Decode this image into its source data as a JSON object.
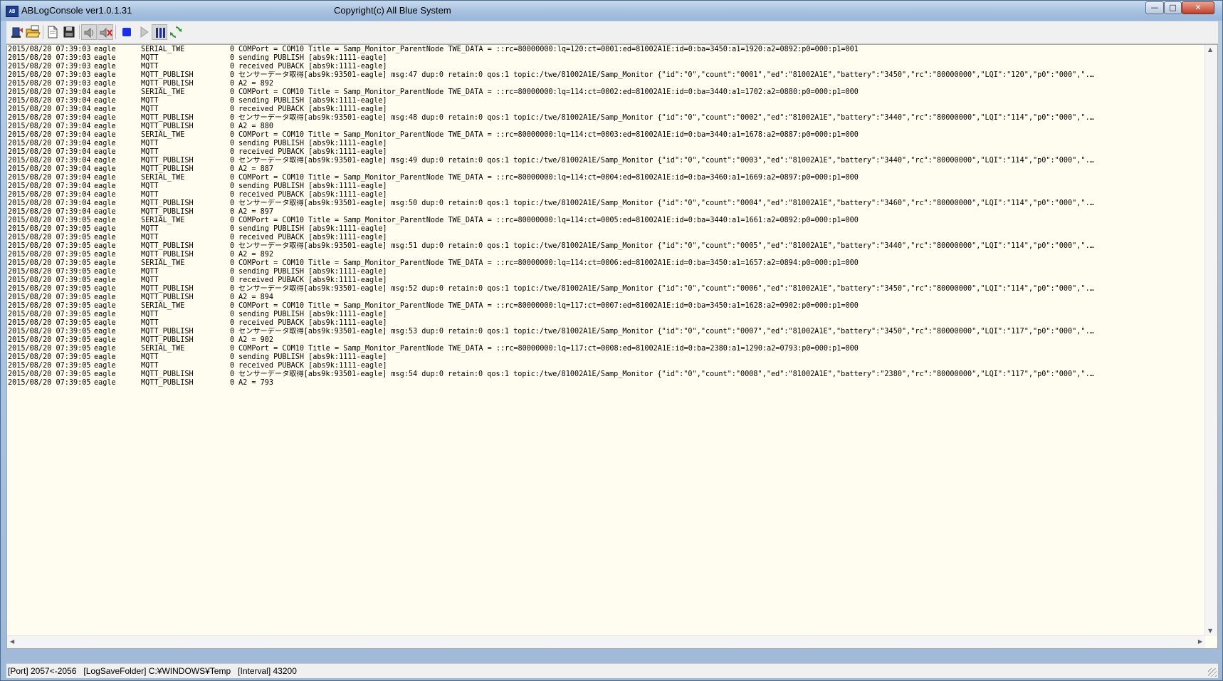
{
  "window": {
    "title": "ABLogConsole ver1.0.1.31",
    "copyright": "Copyright(c) All Blue System",
    "icon_label": "AB",
    "min_glyph": "—",
    "max_glyph": "□",
    "close_glyph": "✕"
  },
  "toolbar": {
    "buttons": [
      {
        "name": "connect-icon"
      },
      {
        "name": "open-log-icon"
      },
      {
        "name": "new-document-icon"
      },
      {
        "name": "save-icon"
      },
      {
        "name": "sound-on-icon"
      },
      {
        "name": "sound-off-icon"
      },
      {
        "name": "stop-icon"
      },
      {
        "name": "play-icon"
      },
      {
        "name": "pause-icon"
      },
      {
        "name": "refresh-icon"
      }
    ]
  },
  "log": {
    "rows": [
      {
        "time": "2015/08/20 07:39:03",
        "host": "eagle",
        "category": "SERIAL_TWE",
        "level": "0",
        "message": "COMPort = COM10 Title = Samp_Monitor_ParentNode TWE_DATA = ::rc=80000000:lq=120:ct=0001:ed=81002A1E:id=0:ba=3450:a1=1920:a2=0892:p0=000:p1=001"
      },
      {
        "time": "2015/08/20 07:39:03",
        "host": "eagle",
        "category": "MQTT",
        "level": "0",
        "message": "sending PUBLISH [abs9k:1111-eagle]"
      },
      {
        "time": "2015/08/20 07:39:03",
        "host": "eagle",
        "category": "MQTT",
        "level": "0",
        "message": "received PUBACK [abs9k:1111-eagle]"
      },
      {
        "time": "2015/08/20 07:39:03",
        "host": "eagle",
        "category": "MQTT_PUBLISH",
        "level": "0",
        "message": "センサーデータ取得[abs9k:93501-eagle] msg:47 dup:0 retain:0 qos:1 topic:/twe/81002A1E/Samp_Monitor {\"id\":\"0\",\"count\":\"0001\",\"ed\":\"81002A1E\",\"battery\":\"3450\",\"rc\":\"80000000\",\"LQI\":\"120\",\"p0\":\"000\",\"..."
      },
      {
        "time": "2015/08/20 07:39:03",
        "host": "eagle",
        "category": "MQTT_PUBLISH",
        "level": "0",
        "message": "A2 = 892"
      },
      {
        "time": "2015/08/20 07:39:04",
        "host": "eagle",
        "category": "SERIAL_TWE",
        "level": "0",
        "message": "COMPort = COM10 Title = Samp_Monitor_ParentNode TWE_DATA = ::rc=80000000:lq=114:ct=0002:ed=81002A1E:id=0:ba=3440:a1=1702:a2=0880:p0=000:p1=000"
      },
      {
        "time": "2015/08/20 07:39:04",
        "host": "eagle",
        "category": "MQTT",
        "level": "0",
        "message": "sending PUBLISH [abs9k:1111-eagle]"
      },
      {
        "time": "2015/08/20 07:39:04",
        "host": "eagle",
        "category": "MQTT",
        "level": "0",
        "message": "received PUBACK [abs9k:1111-eagle]"
      },
      {
        "time": "2015/08/20 07:39:04",
        "host": "eagle",
        "category": "MQTT_PUBLISH",
        "level": "0",
        "message": "センサーデータ取得[abs9k:93501-eagle] msg:48 dup:0 retain:0 qos:1 topic:/twe/81002A1E/Samp_Monitor {\"id\":\"0\",\"count\":\"0002\",\"ed\":\"81002A1E\",\"battery\":\"3440\",\"rc\":\"80000000\",\"LQI\":\"114\",\"p0\":\"000\",\"..."
      },
      {
        "time": "2015/08/20 07:39:04",
        "host": "eagle",
        "category": "MQTT_PUBLISH",
        "level": "0",
        "message": "A2 = 880"
      },
      {
        "time": "2015/08/20 07:39:04",
        "host": "eagle",
        "category": "SERIAL_TWE",
        "level": "0",
        "message": "COMPort = COM10 Title = Samp_Monitor_ParentNode TWE_DATA = ::rc=80000000:lq=114:ct=0003:ed=81002A1E:id=0:ba=3440:a1=1678:a2=0887:p0=000:p1=000"
      },
      {
        "time": "2015/08/20 07:39:04",
        "host": "eagle",
        "category": "MQTT",
        "level": "0",
        "message": "sending PUBLISH [abs9k:1111-eagle]"
      },
      {
        "time": "2015/08/20 07:39:04",
        "host": "eagle",
        "category": "MQTT",
        "level": "0",
        "message": "received PUBACK [abs9k:1111-eagle]"
      },
      {
        "time": "2015/08/20 07:39:04",
        "host": "eagle",
        "category": "MQTT_PUBLISH",
        "level": "0",
        "message": "センサーデータ取得[abs9k:93501-eagle] msg:49 dup:0 retain:0 qos:1 topic:/twe/81002A1E/Samp_Monitor {\"id\":\"0\",\"count\":\"0003\",\"ed\":\"81002A1E\",\"battery\":\"3440\",\"rc\":\"80000000\",\"LQI\":\"114\",\"p0\":\"000\",\"..."
      },
      {
        "time": "2015/08/20 07:39:04",
        "host": "eagle",
        "category": "MQTT_PUBLISH",
        "level": "0",
        "message": "A2 = 887"
      },
      {
        "time": "2015/08/20 07:39:04",
        "host": "eagle",
        "category": "SERIAL_TWE",
        "level": "0",
        "message": "COMPort = COM10 Title = Samp_Monitor_ParentNode TWE_DATA = ::rc=80000000:lq=114:ct=0004:ed=81002A1E:id=0:ba=3460:a1=1669:a2=0897:p0=000:p1=000"
      },
      {
        "time": "2015/08/20 07:39:04",
        "host": "eagle",
        "category": "MQTT",
        "level": "0",
        "message": "sending PUBLISH [abs9k:1111-eagle]"
      },
      {
        "time": "2015/08/20 07:39:04",
        "host": "eagle",
        "category": "MQTT",
        "level": "0",
        "message": "received PUBACK [abs9k:1111-eagle]"
      },
      {
        "time": "2015/08/20 07:39:04",
        "host": "eagle",
        "category": "MQTT_PUBLISH",
        "level": "0",
        "message": "センサーデータ取得[abs9k:93501-eagle] msg:50 dup:0 retain:0 qos:1 topic:/twe/81002A1E/Samp_Monitor {\"id\":\"0\",\"count\":\"0004\",\"ed\":\"81002A1E\",\"battery\":\"3460\",\"rc\":\"80000000\",\"LQI\":\"114\",\"p0\":\"000\",\"..."
      },
      {
        "time": "2015/08/20 07:39:04",
        "host": "eagle",
        "category": "MQTT_PUBLISH",
        "level": "0",
        "message": "A2 = 897"
      },
      {
        "time": "2015/08/20 07:39:05",
        "host": "eagle",
        "category": "SERIAL_TWE",
        "level": "0",
        "message": "COMPort = COM10 Title = Samp_Monitor_ParentNode TWE_DATA = ::rc=80000000:lq=114:ct=0005:ed=81002A1E:id=0:ba=3440:a1=1661:a2=0892:p0=000:p1=000"
      },
      {
        "time": "2015/08/20 07:39:05",
        "host": "eagle",
        "category": "MQTT",
        "level": "0",
        "message": "sending PUBLISH [abs9k:1111-eagle]"
      },
      {
        "time": "2015/08/20 07:39:05",
        "host": "eagle",
        "category": "MQTT",
        "level": "0",
        "message": "received PUBACK [abs9k:1111-eagle]"
      },
      {
        "time": "2015/08/20 07:39:05",
        "host": "eagle",
        "category": "MQTT_PUBLISH",
        "level": "0",
        "message": "センサーデータ取得[abs9k:93501-eagle] msg:51 dup:0 retain:0 qos:1 topic:/twe/81002A1E/Samp_Monitor {\"id\":\"0\",\"count\":\"0005\",\"ed\":\"81002A1E\",\"battery\":\"3440\",\"rc\":\"80000000\",\"LQI\":\"114\",\"p0\":\"000\",\"..."
      },
      {
        "time": "2015/08/20 07:39:05",
        "host": "eagle",
        "category": "MQTT_PUBLISH",
        "level": "0",
        "message": "A2 = 892"
      },
      {
        "time": "2015/08/20 07:39:05",
        "host": "eagle",
        "category": "SERIAL_TWE",
        "level": "0",
        "message": "COMPort = COM10 Title = Samp_Monitor_ParentNode TWE_DATA = ::rc=80000000:lq=114:ct=0006:ed=81002A1E:id=0:ba=3450:a1=1657:a2=0894:p0=000:p1=000"
      },
      {
        "time": "2015/08/20 07:39:05",
        "host": "eagle",
        "category": "MQTT",
        "level": "0",
        "message": "sending PUBLISH [abs9k:1111-eagle]"
      },
      {
        "time": "2015/08/20 07:39:05",
        "host": "eagle",
        "category": "MQTT",
        "level": "0",
        "message": "received PUBACK [abs9k:1111-eagle]"
      },
      {
        "time": "2015/08/20 07:39:05",
        "host": "eagle",
        "category": "MQTT_PUBLISH",
        "level": "0",
        "message": "センサーデータ取得[abs9k:93501-eagle] msg:52 dup:0 retain:0 qos:1 topic:/twe/81002A1E/Samp_Monitor {\"id\":\"0\",\"count\":\"0006\",\"ed\":\"81002A1E\",\"battery\":\"3450\",\"rc\":\"80000000\",\"LQI\":\"114\",\"p0\":\"000\",\"..."
      },
      {
        "time": "2015/08/20 07:39:05",
        "host": "eagle",
        "category": "MQTT_PUBLISH",
        "level": "0",
        "message": "A2 = 894"
      },
      {
        "time": "2015/08/20 07:39:05",
        "host": "eagle",
        "category": "SERIAL_TWE",
        "level": "0",
        "message": "COMPort = COM10 Title = Samp_Monitor_ParentNode TWE_DATA = ::rc=80000000:lq=117:ct=0007:ed=81002A1E:id=0:ba=3450:a1=1628:a2=0902:p0=000:p1=000"
      },
      {
        "time": "2015/08/20 07:39:05",
        "host": "eagle",
        "category": "MQTT",
        "level": "0",
        "message": "sending PUBLISH [abs9k:1111-eagle]"
      },
      {
        "time": "2015/08/20 07:39:05",
        "host": "eagle",
        "category": "MQTT",
        "level": "0",
        "message": "received PUBACK [abs9k:1111-eagle]"
      },
      {
        "time": "2015/08/20 07:39:05",
        "host": "eagle",
        "category": "MQTT_PUBLISH",
        "level": "0",
        "message": "センサーデータ取得[abs9k:93501-eagle] msg:53 dup:0 retain:0 qos:1 topic:/twe/81002A1E/Samp_Monitor {\"id\":\"0\",\"count\":\"0007\",\"ed\":\"81002A1E\",\"battery\":\"3450\",\"rc\":\"80000000\",\"LQI\":\"117\",\"p0\":\"000\",\"..."
      },
      {
        "time": "2015/08/20 07:39:05",
        "host": "eagle",
        "category": "MQTT_PUBLISH",
        "level": "0",
        "message": "A2 = 902"
      },
      {
        "time": "2015/08/20 07:39:05",
        "host": "eagle",
        "category": "SERIAL_TWE",
        "level": "0",
        "message": "COMPort = COM10 Title = Samp_Monitor_ParentNode TWE_DATA = ::rc=80000000:lq=117:ct=0008:ed=81002A1E:id=0:ba=2380:a1=1290:a2=0793:p0=000:p1=000"
      },
      {
        "time": "2015/08/20 07:39:05",
        "host": "eagle",
        "category": "MQTT",
        "level": "0",
        "message": "sending PUBLISH [abs9k:1111-eagle]"
      },
      {
        "time": "2015/08/20 07:39:05",
        "host": "eagle",
        "category": "MQTT",
        "level": "0",
        "message": "received PUBACK [abs9k:1111-eagle]"
      },
      {
        "time": "2015/08/20 07:39:05",
        "host": "eagle",
        "category": "MQTT_PUBLISH",
        "level": "0",
        "message": "センサーデータ取得[abs9k:93501-eagle] msg:54 dup:0 retain:0 qos:1 topic:/twe/81002A1E/Samp_Monitor {\"id\":\"0\",\"count\":\"0008\",\"ed\":\"81002A1E\",\"battery\":\"2380\",\"rc\":\"80000000\",\"LQI\":\"117\",\"p0\":\"000\",\"..."
      },
      {
        "time": "2015/08/20 07:39:05",
        "host": "eagle",
        "category": "MQTT_PUBLISH",
        "level": "0",
        "message": "A2 = 793"
      }
    ]
  },
  "status": {
    "text": "[Port] 2057<-2056   [LogSaveFolder] C:¥WINDOWS¥Temp   [Interval] 43200"
  },
  "colors": {
    "log_background": "#fffcf0",
    "stop_blue": "#1a2fe8",
    "refresh_green": "#2e9a2e"
  }
}
